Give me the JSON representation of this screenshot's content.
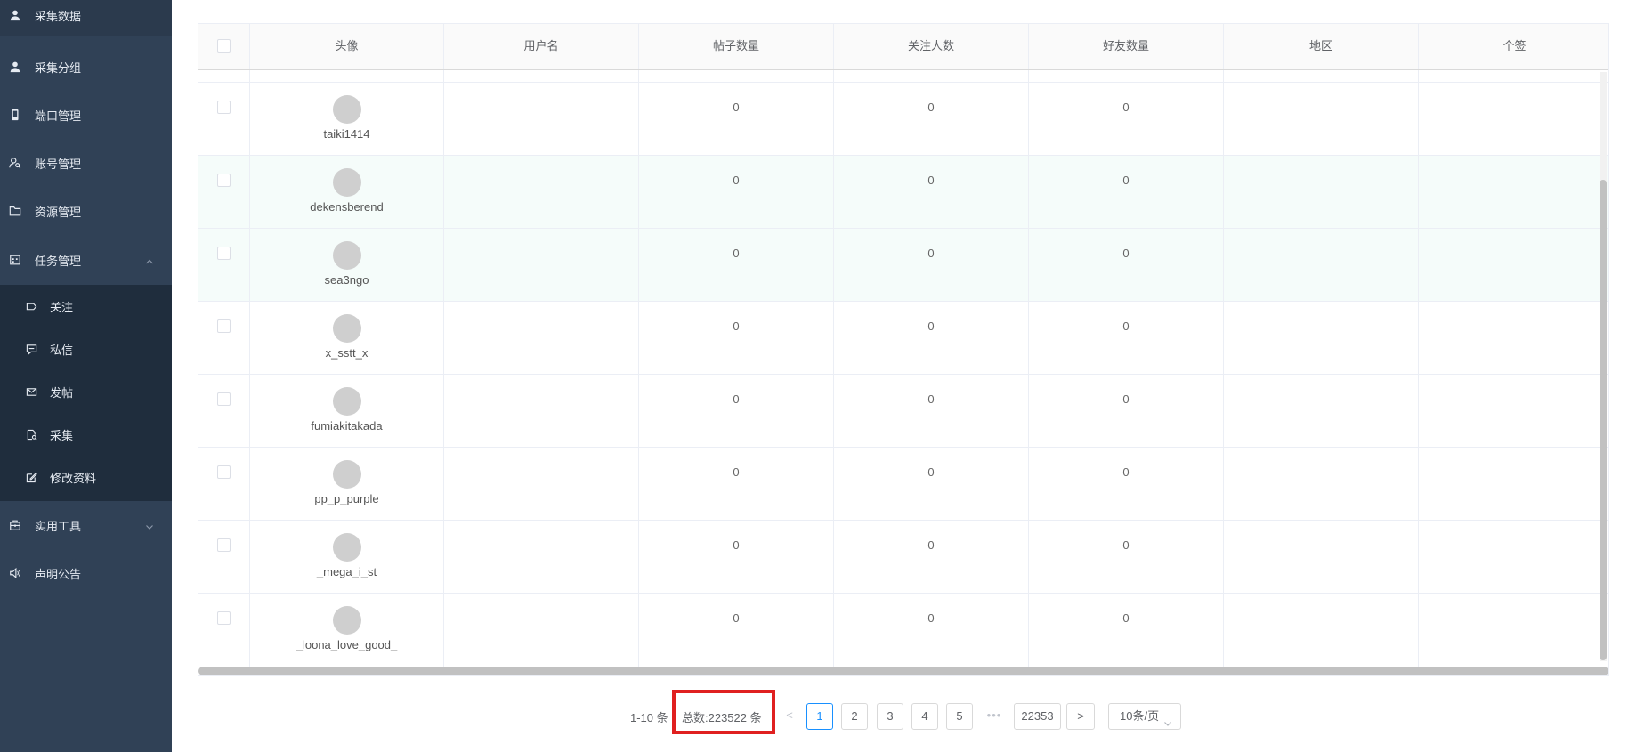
{
  "sidebar": {
    "items": [
      {
        "label": "采集数据",
        "icon": "user-icon"
      },
      {
        "label": "采集分组",
        "icon": "user-icon"
      },
      {
        "label": "端口管理",
        "icon": "phone-icon"
      },
      {
        "label": "账号管理",
        "icon": "user-search-icon"
      },
      {
        "label": "资源管理",
        "icon": "folder-icon"
      },
      {
        "label": "任务管理",
        "icon": "calendar-icon"
      },
      {
        "label": "实用工具",
        "icon": "toolbox-icon"
      },
      {
        "label": "声明公告",
        "icon": "speaker-icon"
      }
    ],
    "subitems": [
      {
        "label": "关注",
        "icon": "tag-icon"
      },
      {
        "label": "私信",
        "icon": "message-icon"
      },
      {
        "label": "发帖",
        "icon": "mail-icon"
      },
      {
        "label": "采集",
        "icon": "document-search-icon"
      },
      {
        "label": "修改资料",
        "icon": "edit-icon"
      }
    ]
  },
  "table": {
    "headers": [
      "头像",
      "用户名",
      "帖子数量",
      "关注人数",
      "好友数量",
      "地区",
      "个签"
    ],
    "rows": [
      {
        "name": "taiki1414",
        "posts": "0",
        "follows": "0",
        "friends": "0"
      },
      {
        "name": "dekensberend",
        "posts": "0",
        "follows": "0",
        "friends": "0"
      },
      {
        "name": "sea3ngo",
        "posts": "0",
        "follows": "0",
        "friends": "0"
      },
      {
        "name": "x_sstt_x",
        "posts": "0",
        "follows": "0",
        "friends": "0"
      },
      {
        "name": "fumiakitakada",
        "posts": "0",
        "follows": "0",
        "friends": "0"
      },
      {
        "name": "pp_p_purple",
        "posts": "0",
        "follows": "0",
        "friends": "0"
      },
      {
        "name": "_mega_i_st",
        "posts": "0",
        "follows": "0",
        "friends": "0"
      },
      {
        "name": "_loona_love_good_",
        "posts": "0",
        "follows": "0",
        "friends": "0"
      }
    ]
  },
  "pagination": {
    "range": "1-10 条",
    "total": "总数:223522 条",
    "prev": "<",
    "next": ">",
    "pages": [
      "1",
      "2",
      "3",
      "4",
      "5"
    ],
    "ellipsis": "•••",
    "last": "22353",
    "page_size": "10条/页",
    "active_page": "1"
  },
  "colors": {
    "sidebar_bg": "#304156",
    "submenu_bg": "#1f2d3d",
    "accent": "#1890ff",
    "highlight_box": "#e02020"
  }
}
